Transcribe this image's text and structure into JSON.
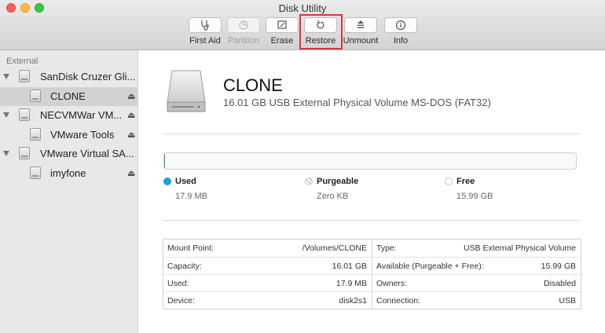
{
  "window": {
    "title": "Disk Utility"
  },
  "toolbar": {
    "buttons": [
      {
        "label": "First Aid",
        "icon": "stethoscope-icon",
        "enabled": true
      },
      {
        "label": "Partition",
        "icon": "pie-chart-icon",
        "enabled": false
      },
      {
        "label": "Erase",
        "icon": "erase-icon",
        "enabled": true
      },
      {
        "label": "Restore",
        "icon": "restore-icon",
        "enabled": true,
        "highlighted": true
      },
      {
        "label": "Unmount",
        "icon": "unmount-icon",
        "enabled": true
      },
      {
        "label": "Info",
        "icon": "info-icon",
        "enabled": true
      }
    ]
  },
  "sidebar": {
    "header": "External",
    "items": [
      {
        "label": "SanDisk Cruzer Gli...",
        "level": 0,
        "expanded": true,
        "selected": false,
        "ejectable": false
      },
      {
        "label": "CLONE",
        "level": 1,
        "selected": true,
        "ejectable": true
      },
      {
        "label": "NECVMWar VM...",
        "level": 0,
        "expanded": true,
        "selected": false,
        "ejectable": true
      },
      {
        "label": "VMware Tools",
        "level": 1,
        "selected": false,
        "ejectable": true
      },
      {
        "label": "VMware Virtual SA...",
        "level": 0,
        "expanded": true,
        "selected": false,
        "ejectable": false
      },
      {
        "label": "imyfone",
        "level": 1,
        "selected": false,
        "ejectable": true
      }
    ],
    "eject_glyph": "⏏"
  },
  "volume": {
    "name": "CLONE",
    "description": "16.01 GB USB External Physical Volume MS-DOS (FAT32)"
  },
  "usage": {
    "used_fraction": 0.0011,
    "used_color": "#1a9de3",
    "legend": [
      {
        "label": "Used",
        "value": "17.9 MB"
      },
      {
        "label": "Purgeable",
        "value": "Zero KB"
      },
      {
        "label": "Free",
        "value": "15.99 GB"
      }
    ]
  },
  "info": {
    "left": [
      {
        "key": "Mount Point:",
        "value": "/Volumes/CLONE"
      },
      {
        "key": "Capacity:",
        "value": "16.01 GB"
      },
      {
        "key": "Used:",
        "value": "17.9 MB"
      },
      {
        "key": "Device:",
        "value": "disk2s1"
      }
    ],
    "right": [
      {
        "key": "Type:",
        "value": "USB External Physical Volume"
      },
      {
        "key": "Available (Purgeable + Free):",
        "value": "15.99 GB"
      },
      {
        "key": "Owners:",
        "value": "Disabled"
      },
      {
        "key": "Connection:",
        "value": "USB"
      }
    ]
  },
  "colors": {
    "highlight": "#d9363e",
    "accent": "#2b9ee6"
  }
}
